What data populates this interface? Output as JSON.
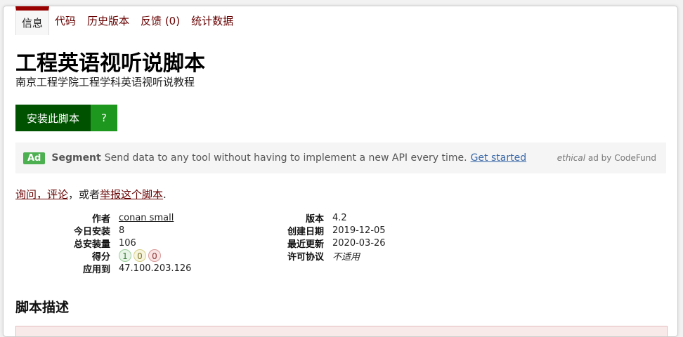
{
  "tabs": [
    "信息",
    "代码",
    "历史版本",
    "反馈 (0)",
    "统计数据"
  ],
  "script": {
    "title": "工程英语视听说脚本",
    "subtitle": "南京工程学院工程学科英语视听说教程"
  },
  "install": {
    "label": "安装此脚本",
    "help": "?"
  },
  "ad": {
    "badge": "Ad",
    "brand": "Segment",
    "text": "Send data to any tool without having to implement a new API every time.",
    "link": "Get started",
    "credit_em": "ethical",
    "credit": "ad by CodeFund"
  },
  "feedback": {
    "ask": "询问，评论",
    "middle": "，或者",
    "report": "举报这个脚本",
    "end": "."
  },
  "meta_left": {
    "author_label": "作者",
    "author": "conan small",
    "today_label": "今日安装",
    "today": "8",
    "total_label": "总安装量",
    "total": "106",
    "score_label": "得分",
    "score_good": "1",
    "score_ok": "0",
    "score_bad": "0",
    "applies_label": "应用到",
    "applies": "47.100.203.126"
  },
  "meta_right": {
    "version_label": "版本",
    "version": "4.2",
    "created_label": "创建日期",
    "created": "2019-12-05",
    "updated_label": "最近更新",
    "updated": "2020-03-26",
    "license_label": "许可协议",
    "license": "不适用"
  },
  "description_heading": "脚本描述",
  "colors": {
    "accent": "#990000",
    "link": "#670000",
    "install": "#005200",
    "help": "#1e971e"
  }
}
